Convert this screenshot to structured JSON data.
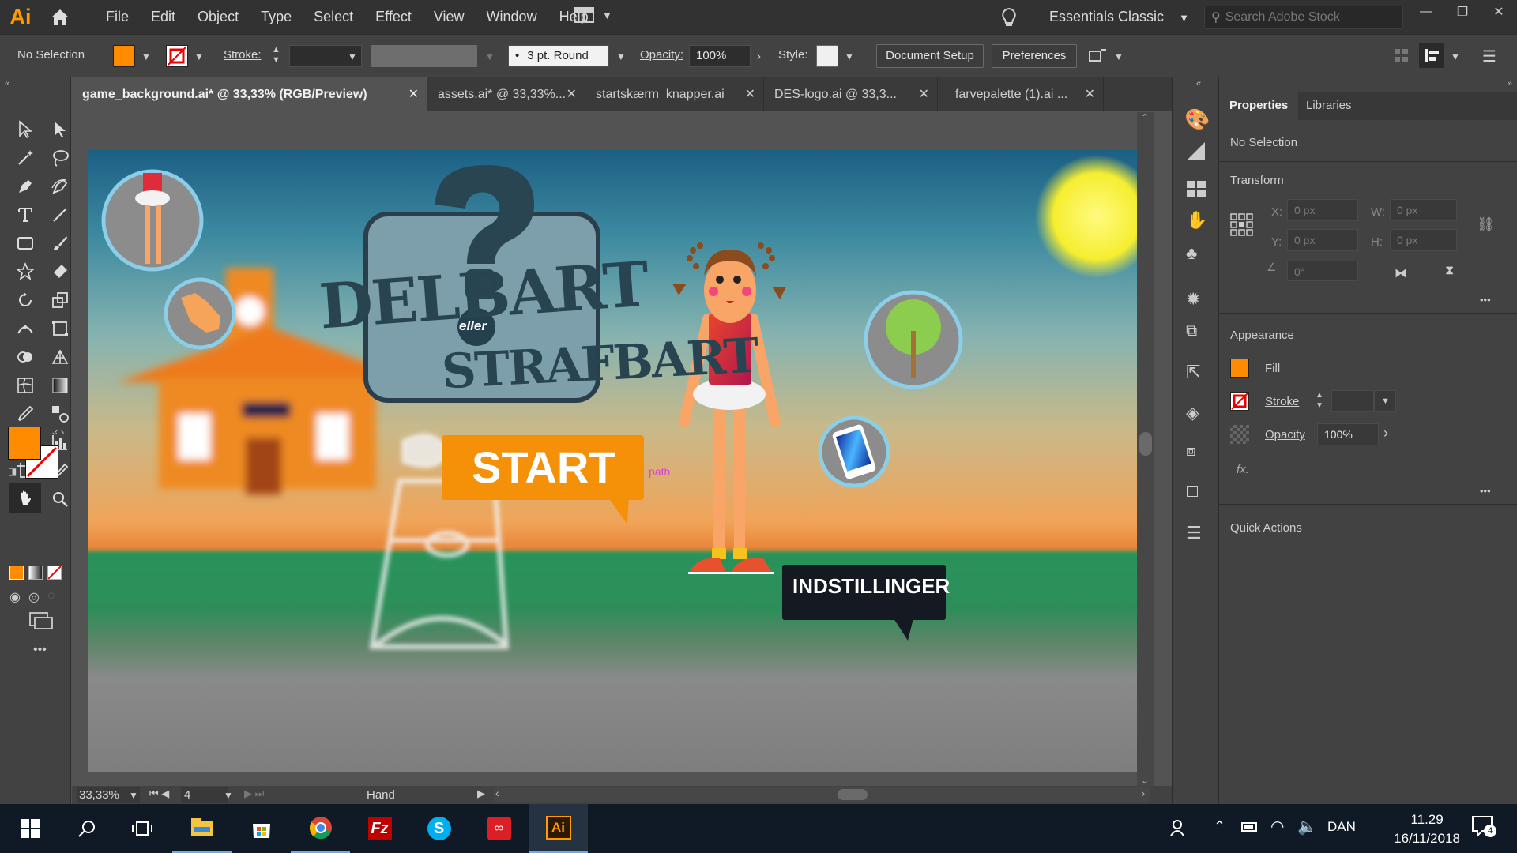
{
  "app": {
    "logo": "Ai",
    "workspace": "Essentials Classic",
    "search_placeholder": "Search Adobe Stock"
  },
  "menu": [
    "File",
    "Edit",
    "Object",
    "Type",
    "Select",
    "Effect",
    "View",
    "Window",
    "Help"
  ],
  "control_bar": {
    "selection": "No Selection",
    "stroke_label": "Stroke:",
    "brush": "3 pt. Round",
    "opacity_label": "Opacity:",
    "opacity_value": "100%",
    "style_label": "Style:",
    "document_setup": "Document Setup",
    "preferences": "Preferences"
  },
  "colors": {
    "fill": "#ff8c00",
    "accent": "#ff9a00"
  },
  "tabs": [
    {
      "label": "game_background.ai* @ 33,33% (RGB/Preview)",
      "active": true
    },
    {
      "label": "assets.ai* @ 33,33%...",
      "active": false
    },
    {
      "label": "startskærm_knapper.ai",
      "active": false
    },
    {
      "label": "DES-logo.ai @ 33,3...",
      "active": false
    },
    {
      "label": "_farvepalette (1).ai ...",
      "active": false
    }
  ],
  "artwork": {
    "title_main": "DELBART",
    "title_conj": "eller",
    "title_second": "STRAFBART",
    "start_button": "START",
    "settings_button": "INDSTILLINGER",
    "cursor_hint": "path",
    "question_mark": "?"
  },
  "status": {
    "zoom": "33,33%",
    "artboard_number": "4",
    "current_tool": "Hand"
  },
  "panel": {
    "tabs": [
      "Properties",
      "Libraries"
    ],
    "selection": "No Selection",
    "transform": {
      "title": "Transform",
      "x_label": "X:",
      "x_value": "0 px",
      "y_label": "Y:",
      "y_value": "0 px",
      "w_label": "W:",
      "w_value": "0 px",
      "h_label": "H:",
      "h_value": "0 px",
      "angle_value": "0°"
    },
    "appearance": {
      "title": "Appearance",
      "fill_label": "Fill",
      "stroke_label": "Stroke",
      "opacity_label": "Opacity",
      "opacity_value": "100%",
      "fx_label": "fx."
    },
    "quick_actions": "Quick Actions",
    "more": "•••"
  },
  "taskbar": {
    "language": "DAN",
    "time": "11.29",
    "date": "16/11/2018",
    "notifications": "4"
  }
}
